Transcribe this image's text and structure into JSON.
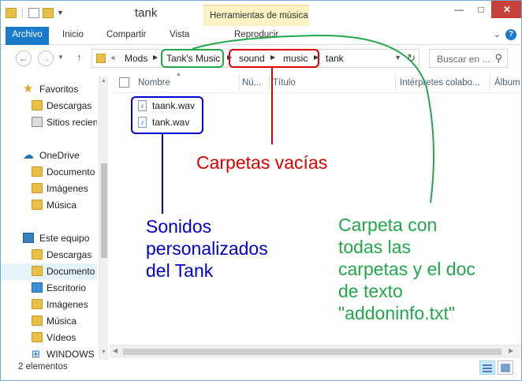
{
  "window": {
    "title": "tank",
    "contextual_tab": "Herramientas de música"
  },
  "ribbon": {
    "tabs": [
      "Archivo",
      "Inicio",
      "Compartir",
      "Vista",
      "Reproducir"
    ]
  },
  "address": {
    "crumbs": [
      "Mods",
      "Tank's Music",
      "sound",
      "music",
      "tank"
    ],
    "overflow": "«",
    "search_placeholder": "Buscar en ..."
  },
  "sidebar": {
    "items": [
      {
        "label": "Favoritos",
        "icon": "star-icon"
      },
      {
        "label": "Descargas",
        "icon": "folder-icon"
      },
      {
        "label": "Sitios recien",
        "icon": "recent-places-icon"
      },
      {
        "label": "OneDrive",
        "icon": "cloud-icon"
      },
      {
        "label": "Documento",
        "icon": "folder-icon"
      },
      {
        "label": "Imágenes",
        "icon": "folder-icon"
      },
      {
        "label": "Música",
        "icon": "folder-icon"
      },
      {
        "label": "Este equipo",
        "icon": "computer-icon"
      },
      {
        "label": "Descargas",
        "icon": "folder-icon"
      },
      {
        "label": "Documento",
        "icon": "folder-icon"
      },
      {
        "label": "Escritorio",
        "icon": "folder-icon"
      },
      {
        "label": "Imágenes",
        "icon": "folder-icon"
      },
      {
        "label": "Música",
        "icon": "folder-icon"
      },
      {
        "label": "Vídeos",
        "icon": "folder-icon"
      },
      {
        "label": "WINDOWS",
        "icon": "windows-drive-icon"
      }
    ]
  },
  "columns": [
    "Nombre",
    "Nú...",
    "Título",
    "Intérpretes colabo...",
    "Álbum"
  ],
  "files": [
    {
      "name": "taank.wav"
    },
    {
      "name": "tank.wav"
    }
  ],
  "status": {
    "count": "2 elementos"
  },
  "annotations": {
    "empty_folders": "Carpetas vacías",
    "custom_sounds": [
      "Sonidos",
      "personalizados",
      "del Tank"
    ],
    "main_folder": [
      "Carpeta con",
      "todas las",
      "carpetas y el doc",
      "de texto",
      "\"addoninfo.txt\""
    ]
  },
  "colors": {
    "blue_annotation": "#0000cc",
    "red_annotation": "#dd0000",
    "green_annotation": "#22a84a",
    "file_tab": "#1979ca",
    "contextual_tab": "#fbf2c3"
  }
}
